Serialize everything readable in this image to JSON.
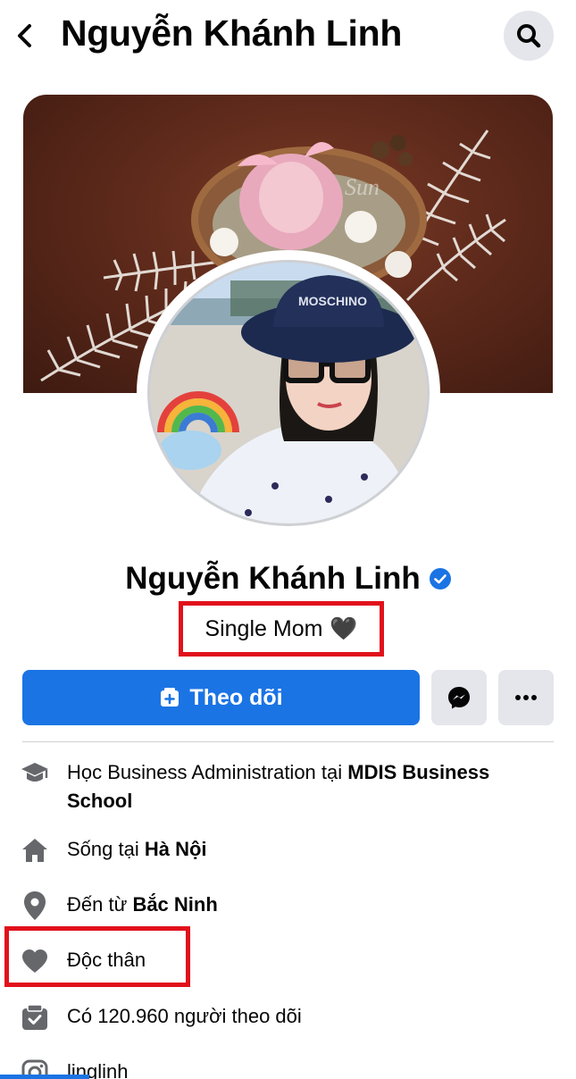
{
  "header": {
    "title": "Nguyễn Khánh Linh"
  },
  "profile": {
    "name": "Nguyễn Khánh Linh",
    "bio": "Single Mom",
    "bio_emoji": "🖤"
  },
  "actions": {
    "follow_label": "Theo dõi"
  },
  "details": {
    "education": {
      "prefix": "Học Business Administration tại ",
      "bold": "MDIS Business School"
    },
    "lives": {
      "prefix": "Sống tại ",
      "bold": "Hà Nội"
    },
    "from": {
      "prefix": "Đến từ ",
      "bold": "Bắc Ninh"
    },
    "relationship": {
      "text": "Độc thân"
    },
    "followers": {
      "text": "Có 120.960 người theo dõi"
    },
    "instagram": {
      "text": "linglinh"
    }
  },
  "colors": {
    "accent": "#1b74e4",
    "highlight": "#e0111b",
    "icon_gray": "#65676b",
    "button_gray": "#e4e6eb"
  },
  "icons": [
    "back-arrow-icon",
    "search-icon",
    "verified-badge-icon",
    "follow-icon",
    "messenger-icon",
    "more-icon",
    "education-icon",
    "home-icon",
    "location-pin-icon",
    "heart-icon",
    "followers-icon",
    "instagram-icon"
  ]
}
